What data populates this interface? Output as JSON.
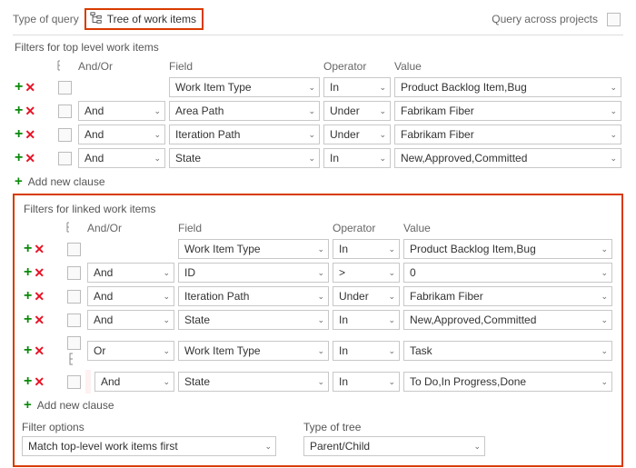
{
  "top": {
    "type_label": "Type of query",
    "query_type": "Tree of work items",
    "cross_projects_label": "Query across projects",
    "cross_projects_checked": false
  },
  "icons": {
    "add": "+",
    "remove": "✕",
    "caret": "⌄"
  },
  "section_top": {
    "title": "Filters for top level work items",
    "headers": {
      "andor": "And/Or",
      "field": "Field",
      "operator": "Operator",
      "value": "Value"
    },
    "rows": [
      {
        "andor": "",
        "field": "Work Item Type",
        "op": "In",
        "value": "Product Backlog Item,Bug"
      },
      {
        "andor": "And",
        "field": "Area Path",
        "op": "Under",
        "value": "Fabrikam Fiber"
      },
      {
        "andor": "And",
        "field": "Iteration Path",
        "op": "Under",
        "value": "Fabrikam Fiber"
      },
      {
        "andor": "And",
        "field": "State",
        "op": "In",
        "value": "New,Approved,Committed"
      }
    ],
    "add_clause": "Add new clause"
  },
  "section_linked": {
    "title": "Filters for linked work items",
    "headers": {
      "andor": "And/Or",
      "field": "Field",
      "operator": "Operator",
      "value": "Value"
    },
    "rows": [
      {
        "andor": "",
        "field": "Work Item Type",
        "op": "In",
        "value": "Product Backlog Item,Bug",
        "group_start": false
      },
      {
        "andor": "And",
        "field": "ID",
        "op": ">",
        "value": "0"
      },
      {
        "andor": "And",
        "field": "Iteration Path",
        "op": "Under",
        "value": "Fabrikam Fiber"
      },
      {
        "andor": "And",
        "field": "State",
        "op": "In",
        "value": "New,Approved,Committed"
      },
      {
        "andor": "Or",
        "field": "Work Item Type",
        "op": "In",
        "value": "Task",
        "group_start": true
      },
      {
        "andor": "And",
        "field": "State",
        "op": "In",
        "value": "To Do,In Progress,Done",
        "indent": true
      }
    ],
    "add_clause": "Add new clause",
    "filter_options_label": "Filter options",
    "filter_options_value": "Match top-level work items first",
    "tree_type_label": "Type of tree",
    "tree_type_value": "Parent/Child"
  }
}
